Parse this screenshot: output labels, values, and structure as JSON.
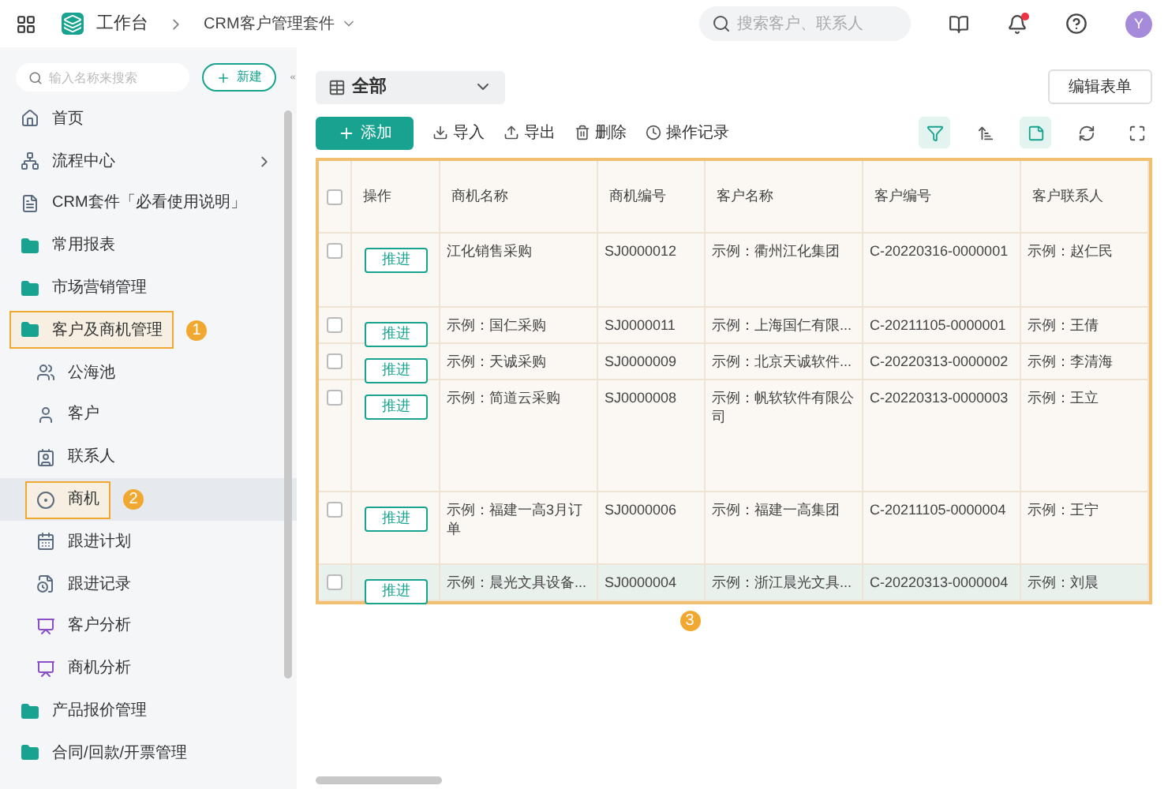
{
  "topbar": {
    "app": "工作台",
    "suite": "CRM客户管理套件",
    "search": {
      "placeholder": "搜索客户、联系人"
    },
    "avatar": "Y",
    "notification_dot": true
  },
  "sidebar": {
    "search": {
      "placeholder": "输入名称来搜索"
    },
    "new_button": "新建",
    "items": [
      {
        "label": "首页",
        "kind": "home",
        "selected": false
      },
      {
        "label": "流程中心",
        "kind": "flow",
        "selected": false,
        "arrow": true
      },
      {
        "label": "CRM套件「必看使用说明」",
        "kind": "doc",
        "selected": false
      },
      {
        "label": "常用报表",
        "kind": "folder",
        "selected": false
      },
      {
        "label": "市场营销管理",
        "kind": "folder",
        "selected": false
      },
      {
        "label": "客户及商机管理",
        "kind": "folder",
        "selected": false,
        "highlighted": true,
        "callout": "1",
        "children": [
          {
            "label": "公海池",
            "kind": "users",
            "selected": false
          },
          {
            "label": "客户",
            "kind": "user",
            "selected": false
          },
          {
            "label": "联系人",
            "kind": "contact",
            "selected": false
          },
          {
            "label": "商机",
            "kind": "target",
            "selected": true,
            "highlighted": true,
            "callout": "2"
          },
          {
            "label": "跟进计划",
            "kind": "calendar",
            "selected": false
          },
          {
            "label": "跟进记录",
            "kind": "record",
            "selected": false
          },
          {
            "label": "客户分析",
            "kind": "chart",
            "selected": false
          },
          {
            "label": "商机分析",
            "kind": "chart",
            "selected": false
          }
        ]
      },
      {
        "label": "产品报价管理",
        "kind": "folder",
        "selected": false
      },
      {
        "label": "合同/回款/开票管理",
        "kind": "folder",
        "selected": false
      }
    ]
  },
  "view_select": "全部",
  "edit_form_button": "编辑表单",
  "toolbar": {
    "add_button": "添加",
    "actions": [
      {
        "label": "导入",
        "kind": "import"
      },
      {
        "label": "导出",
        "kind": "export"
      },
      {
        "label": "删除",
        "kind": "delete"
      },
      {
        "label": "操作记录",
        "kind": "history"
      }
    ],
    "tools": [
      {
        "kind": "filter",
        "active": true
      },
      {
        "kind": "sort",
        "active": false
      },
      {
        "kind": "note",
        "active": true
      },
      {
        "kind": "refresh",
        "active": false
      },
      {
        "kind": "fullscreen",
        "active": false
      }
    ]
  },
  "table": {
    "highlighted": true,
    "callout": "3",
    "all_checked": false,
    "columns": [
      "操作",
      "商机名称",
      "商机编号",
      "客户名称",
      "客户编号",
      "客户联系人"
    ],
    "rows": [
      {
        "cells": [
          "推进",
          "江化销售采购",
          "SJ0000012",
          "示例：衢州江化集团",
          "C-20220316-0000001",
          "示例：赵仁民"
        ],
        "selected": false,
        "checked": false
      },
      {
        "cells": [
          "推进",
          "示例：国仁采购",
          "SJ0000011",
          "示例：上海国仁有限...",
          "C-20211105-0000001",
          "示例：王倩"
        ],
        "selected": false,
        "checked": false
      },
      {
        "cells": [
          "推进",
          "示例：天诚采购",
          "SJ0000009",
          "示例：北京天诚软件...",
          "C-20220313-0000002",
          "示例：李清海"
        ],
        "selected": false,
        "checked": false
      },
      {
        "cells": [
          "推进",
          "示例：简道云采购",
          "SJ0000008",
          "示例：帆软软件有限公司",
          "C-20220313-0000003",
          "示例：王立"
        ],
        "selected": false,
        "checked": false
      },
      {
        "cells": [
          "推进",
          "示例：福建一高3月订单",
          "SJ0000006",
          "示例：福建一高集团",
          "C-20211105-0000004",
          "示例：王宁"
        ],
        "selected": false,
        "checked": false
      },
      {
        "cells": [
          "推进",
          "示例：晨光文具设备...",
          "SJ0000004",
          "示例：浙江晨光文具...",
          "C-20220313-0000004",
          "示例：刘晨"
        ],
        "selected": true,
        "checked": false
      }
    ]
  }
}
